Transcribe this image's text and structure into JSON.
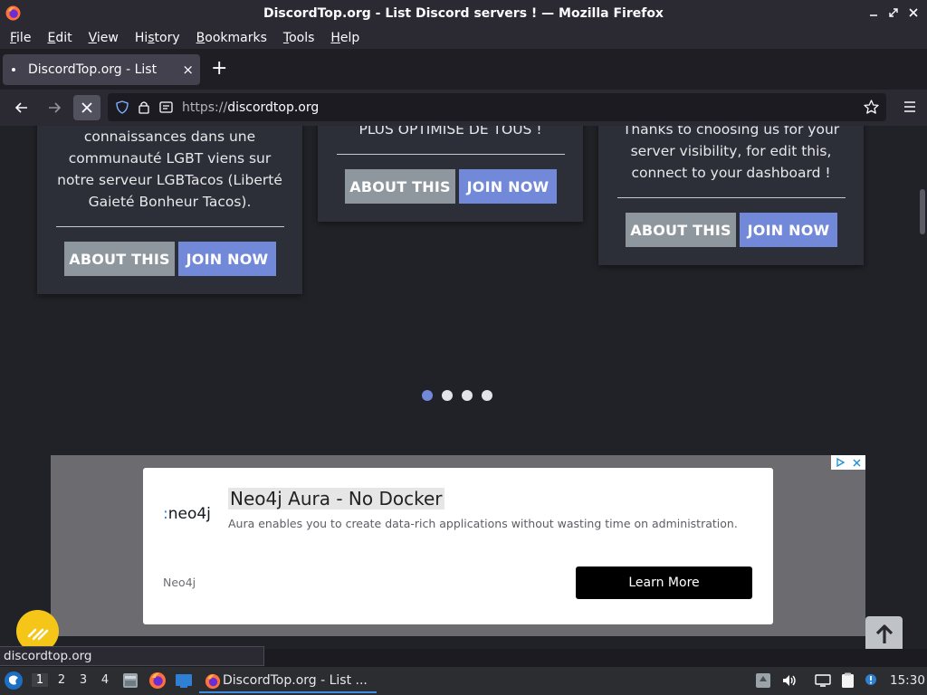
{
  "window": {
    "title": "DiscordTop.org - List Discord servers ! — Mozilla Firefox"
  },
  "menubar": {
    "items": [
      {
        "label": "File",
        "key": "F",
        "rest": "ile"
      },
      {
        "label": "Edit",
        "key": "E",
        "rest": "dit"
      },
      {
        "label": "View",
        "key": "V",
        "rest": "iew"
      },
      {
        "label": "History",
        "key": "H",
        "pre": "Hi",
        "keyc": "s",
        "rest": "tory"
      },
      {
        "label": "Bookmarks",
        "key": "B",
        "rest": "ookmarks"
      },
      {
        "label": "Tools",
        "key": "T",
        "rest": "ools"
      },
      {
        "label": "Help",
        "key": "H",
        "rest": "elp"
      }
    ]
  },
  "tabs": {
    "active_label": "DiscordTop.org - List Disc",
    "close": "×",
    "new_tab": "+"
  },
  "navbar": {
    "url_prefix": "https://",
    "url_domain": "discordtop.org"
  },
  "page": {
    "cards": [
      {
        "desc_lines": [
          "connaissances dans une",
          "communauté LGBT viens sur",
          "notre serveur LGBTacos (Liberté",
          "Gaieté Bonheur Tacos)."
        ],
        "about_label": "ABOUT THIS",
        "join_label": "JOIN NOW"
      },
      {
        "desc_lines": [
          "PLUS OPTIMISE DE TOUS !"
        ],
        "about_label": "ABOUT THIS",
        "join_label": "JOIN NOW"
      },
      {
        "desc_lines": [
          "Thanks to choosing us for your",
          "server visibility, for edit this,",
          "connect to your dashboard !"
        ],
        "about_label": "ABOUT THIS",
        "join_label": "JOIN NOW"
      }
    ],
    "carousel": {
      "slides": 4,
      "active": 1
    },
    "ad": {
      "logo_text": "neo4j",
      "headline": "Neo4j Aura - No Docker",
      "body": "Aura enables you to create data-rich applications without wasting time on administration.",
      "brand": "Neo4j",
      "cta": "Learn More"
    }
  },
  "status": {
    "link_text": "discordtop.org"
  },
  "taskbar": {
    "workspaces": [
      "1",
      "2",
      "3",
      "4"
    ],
    "active_workspace": "1",
    "task_label": "DiscordTop.org - List ...",
    "clock": "15:30"
  },
  "colors": {
    "accent": "#7289da",
    "about_button": "#8e969e",
    "page_bg": "#202227",
    "card_bg": "#2c2f37"
  }
}
